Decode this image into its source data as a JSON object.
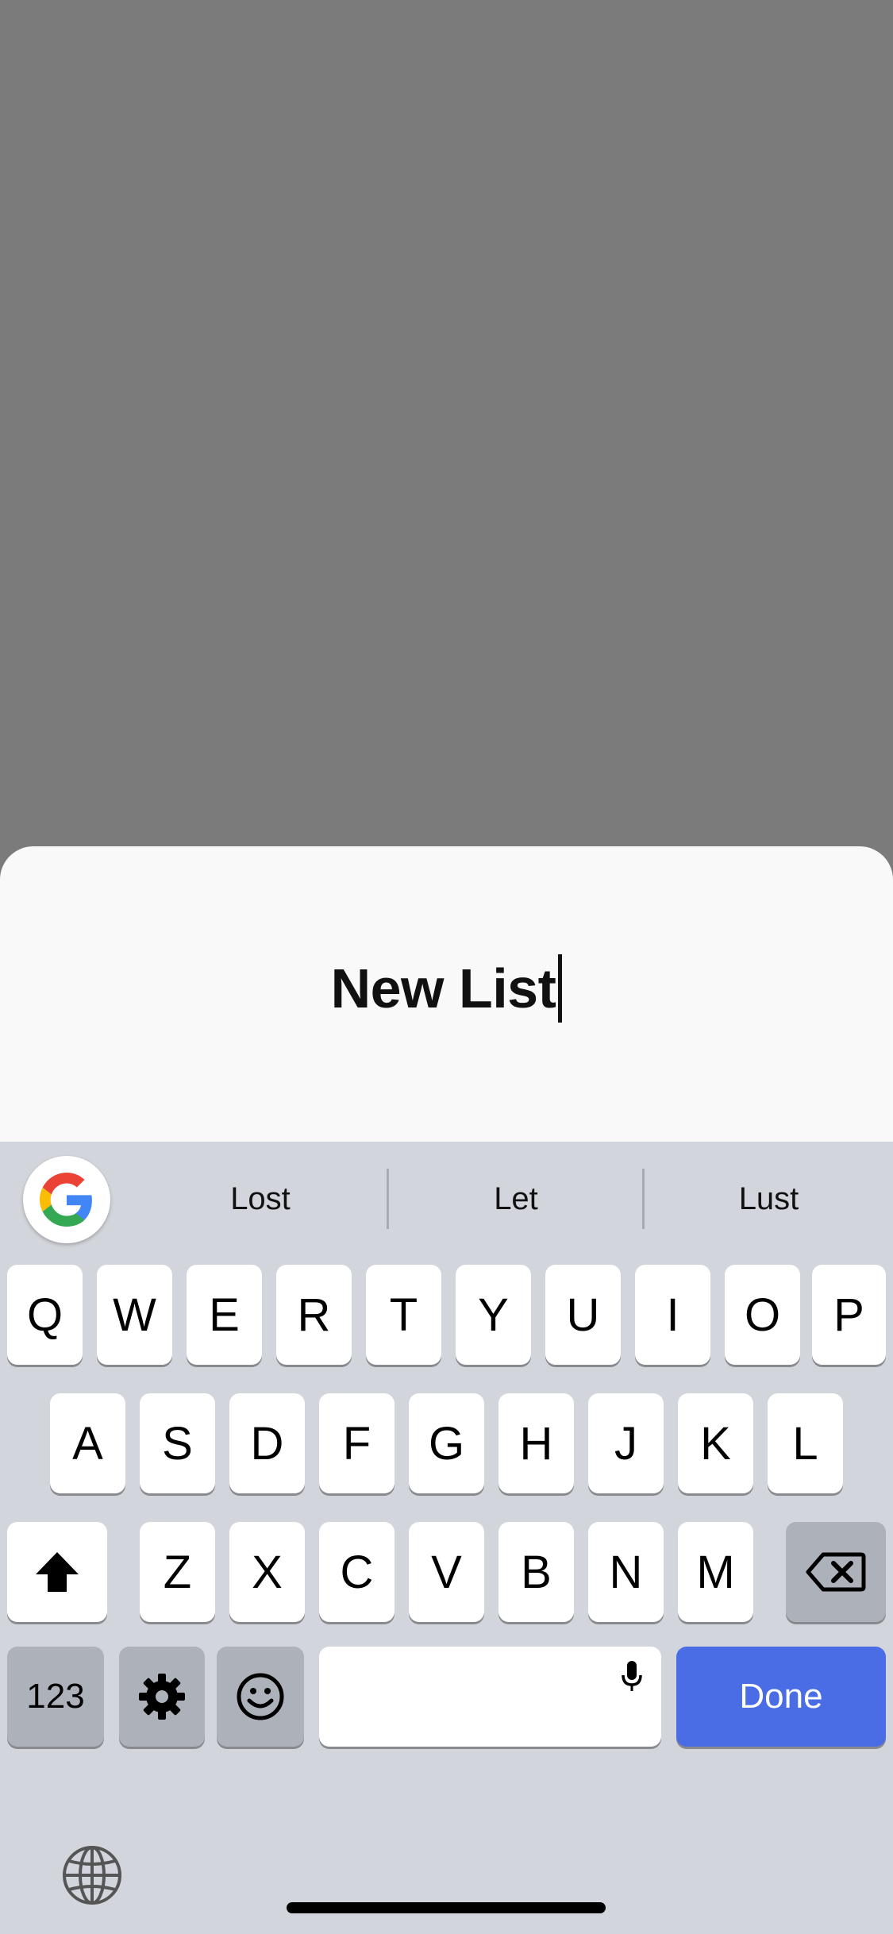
{
  "sheet": {
    "title_value": "New List"
  },
  "keyboard": {
    "suggestions": [
      "Lost",
      "Let",
      "Lust"
    ],
    "row1": [
      "Q",
      "W",
      "E",
      "R",
      "T",
      "Y",
      "U",
      "I",
      "O",
      "P"
    ],
    "row2": [
      "A",
      "S",
      "D",
      "F",
      "G",
      "H",
      "J",
      "K",
      "L"
    ],
    "row3": [
      "Z",
      "X",
      "C",
      "V",
      "B",
      "N",
      "M"
    ],
    "numbers_label": "123",
    "done_label": "Done"
  },
  "icons": [
    "google-icon",
    "shift-icon",
    "backspace-icon",
    "gear-icon",
    "emoji-icon",
    "microphone-icon",
    "globe-icon"
  ],
  "colors": {
    "done_key": "#4a6de5",
    "keyboard_bg": "#d3d5dc",
    "backdrop": "#7b7b7b"
  }
}
